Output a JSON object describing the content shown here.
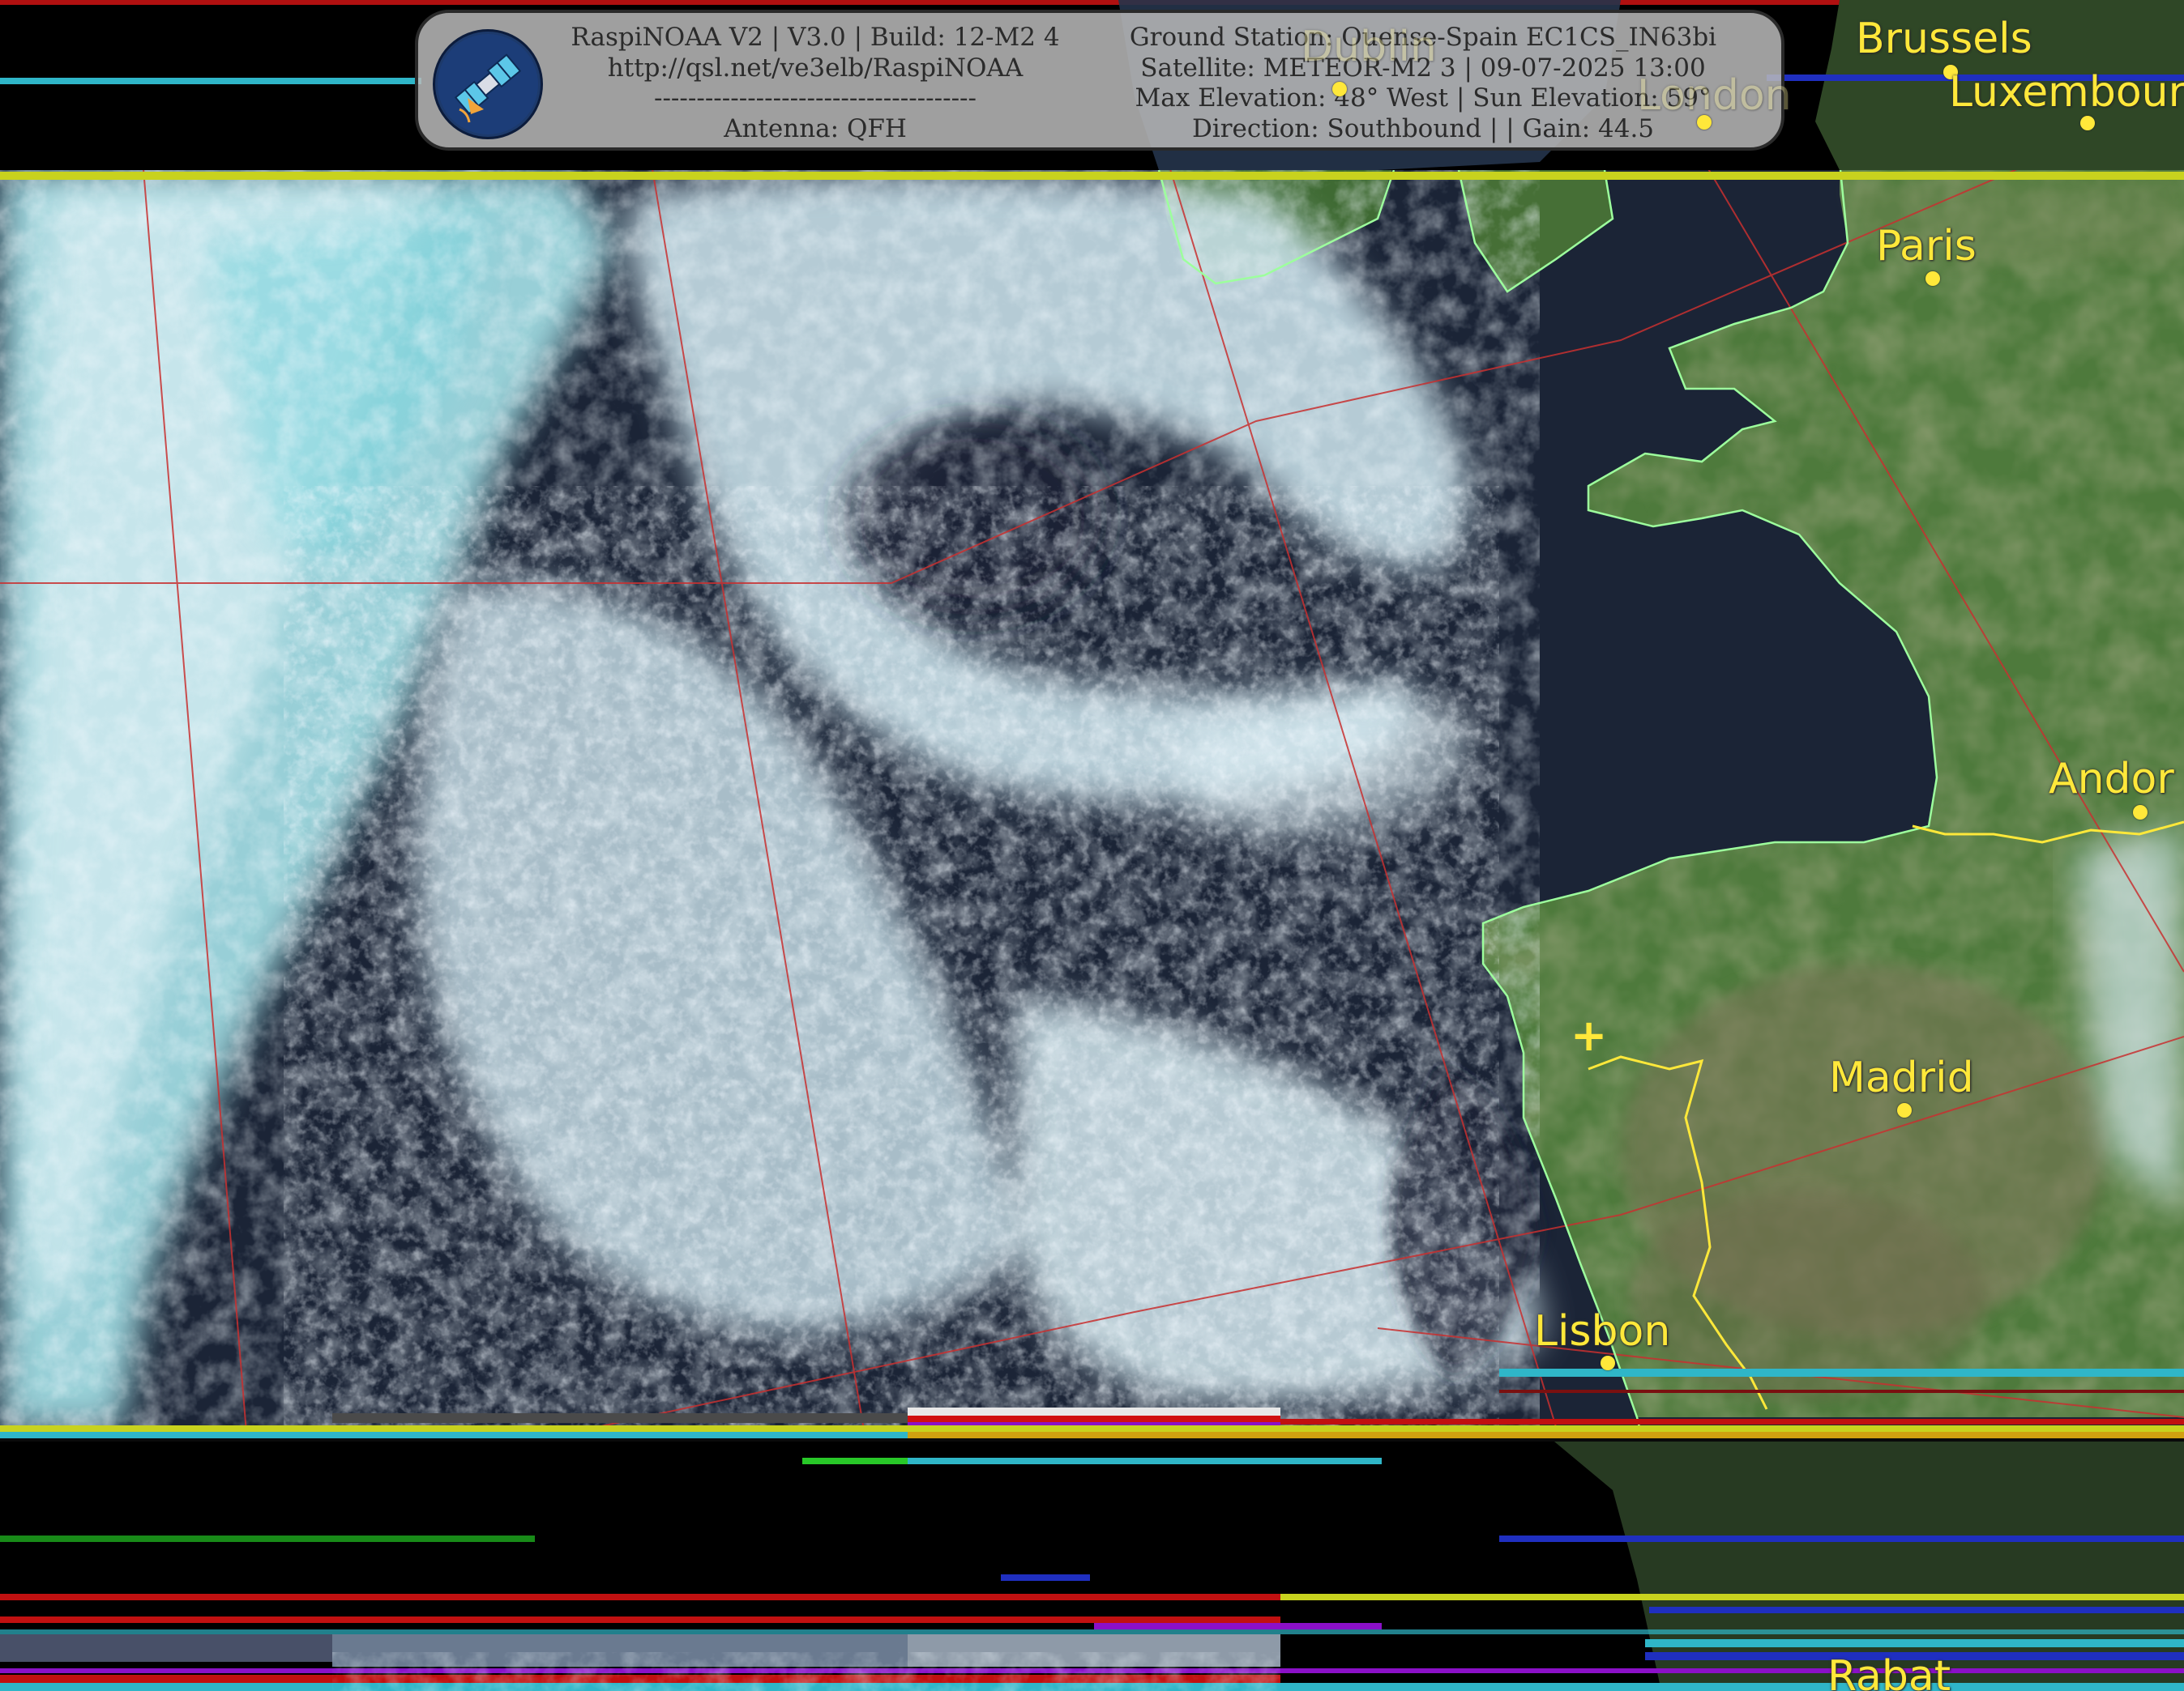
{
  "header": {
    "left_lines": [
      "RaspiNOAA V2 | V3.0 | Build: 12-M2 4",
      "http://qsl.net/ve3elb/RaspiNOAA",
      "--------------------------------------",
      "Antenna: QFH"
    ],
    "right_lines": [
      "Ground Station: Ouense-Spain EC1CS_IN63bi",
      "Satellite: METEOR-M2 3 | 09-07-2025 13:00",
      "Max Elevation: 48° West | Sun Elevation: 59°",
      "Direction: Southbound | | Gain: 44.5"
    ],
    "logo_icon": "satellite-logo-icon"
  },
  "cities": [
    {
      "name": "Brussels",
      "key": "brussels"
    },
    {
      "name": "Luxembour",
      "key": "luxembourg"
    },
    {
      "name": "Paris",
      "key": "paris"
    },
    {
      "name": "Andor",
      "key": "andorra"
    },
    {
      "name": "Madrid",
      "key": "madrid"
    },
    {
      "name": "Lisbon",
      "key": "lisbon"
    },
    {
      "name": "Rabat",
      "key": "rabat"
    },
    {
      "name": "Dublin",
      "key": "dublin"
    },
    {
      "name": "London",
      "key": "london"
    }
  ],
  "colors": {
    "city_label": "#ffe83a",
    "coastline": "#9dff9d",
    "border": "#ffe83a",
    "graticule": "#c83030",
    "ocean": "#1b2436",
    "land": "#4e7a3c",
    "cloud": "#cfe6ee",
    "cloud_cyan": "#7fd6de"
  }
}
